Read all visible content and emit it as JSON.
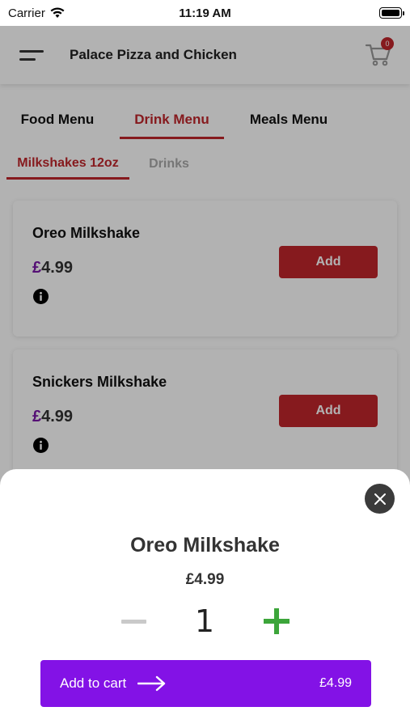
{
  "status": {
    "carrier": "Carrier",
    "time": "11:19 AM"
  },
  "header": {
    "title": "Palace Pizza and Chicken",
    "cart_count": "0"
  },
  "main_tabs": [
    {
      "label": "Food Menu",
      "active": false
    },
    {
      "label": "Drink Menu",
      "active": true
    },
    {
      "label": "Meals Menu",
      "active": false
    }
  ],
  "sub_tabs": [
    {
      "label": "Milkshakes 12oz",
      "active": true
    },
    {
      "label": "Drinks",
      "active": false
    }
  ],
  "items": [
    {
      "name": "Oreo Milkshake",
      "currency": "£",
      "price": "4.99",
      "add_label": "Add"
    },
    {
      "name": "Snickers Milkshake",
      "currency": "£",
      "price": "4.99",
      "add_label": "Add"
    }
  ],
  "sheet": {
    "title": "Oreo Milkshake",
    "price": "£4.99",
    "quantity": "1",
    "add_to_cart_label": "Add to cart",
    "total": "£4.99"
  },
  "colors": {
    "accent_red": "#c0262b",
    "purple": "#8312e6",
    "green": "#3ca53a"
  }
}
